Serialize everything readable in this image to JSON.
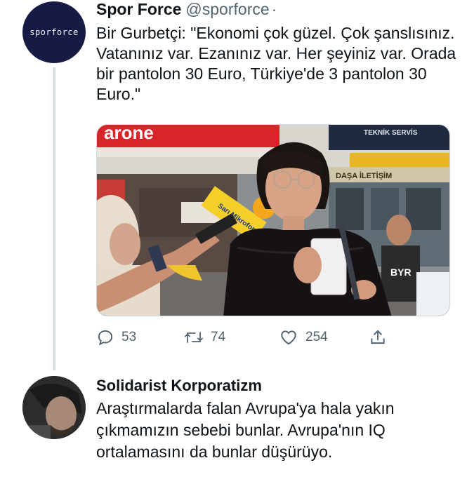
{
  "tweet": {
    "author_name": "Spor Force",
    "author_handle": "@sporforce",
    "separator": "·",
    "avatar_text": "sporforce",
    "text": "Bir Gurbetçi: \"Ekonomi çok güzel. Çok şanslısınız. Vatanınız var. Ezanınız var. Her şeyiniz var. Orada bir pantolon 30 Euro, Türkiye'de 3 pantolon 30 Euro.\"",
    "media": {
      "store_sign": "arone",
      "store_sign2": "TEKNİK SERVİS",
      "store_sign3": "DAŞA İLETİŞİM",
      "mic_label": "Sarı Mikrofon",
      "shirt_text": "BYR"
    },
    "stats": {
      "replies": "53",
      "retweets": "74",
      "likes": "254"
    },
    "icons": {
      "reply": "reply-icon",
      "retweet": "retweet-icon",
      "like": "heart-icon",
      "share": "share-icon"
    }
  },
  "reply": {
    "author_name": "Solidarist Korporatizm",
    "text": "Araştırmalarda falan Avrupa'ya hala yakın çıkmamızın sebebi bunlar. Avrupa'nın IQ ortalamasını da bunlar düşürüyo."
  },
  "colors": {
    "avatar_bg": "#161a44",
    "secondary_text": "#536471",
    "thread_line": "#cfd9de"
  }
}
